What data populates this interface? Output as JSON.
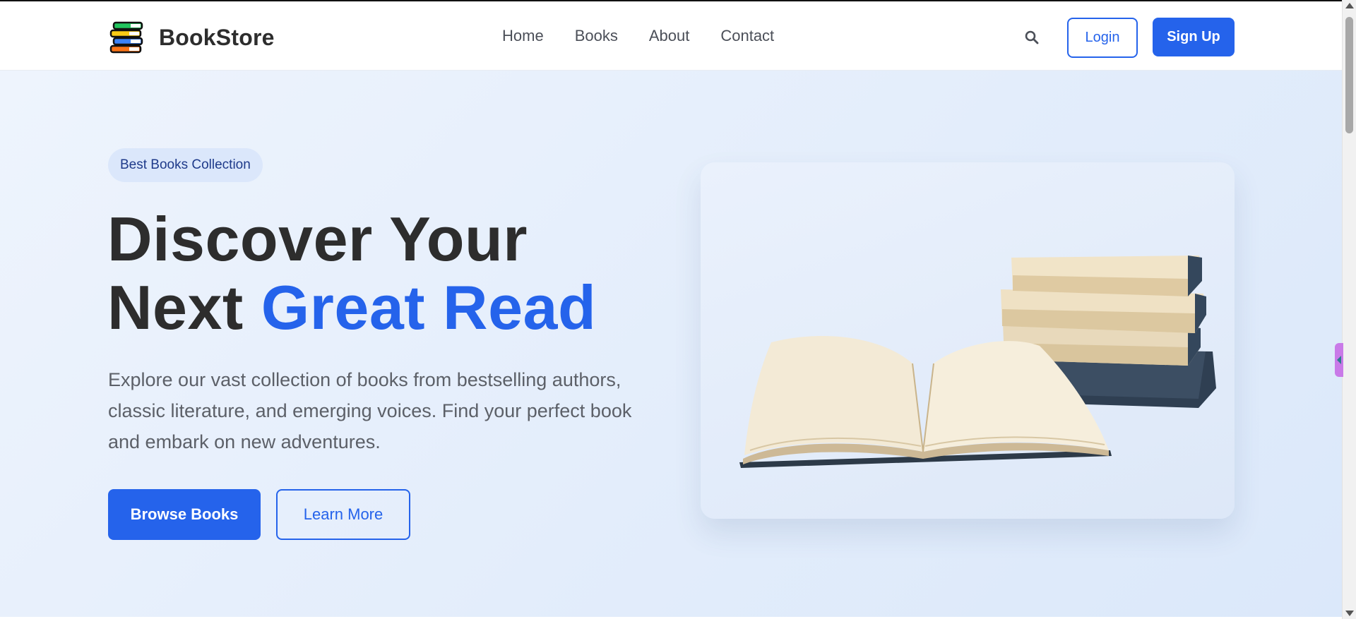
{
  "brand": {
    "name": "BookStore",
    "logo_icon": "book-stack-icon"
  },
  "nav": {
    "items": [
      {
        "label": "Home"
      },
      {
        "label": "Books"
      },
      {
        "label": "About"
      },
      {
        "label": "Contact"
      }
    ]
  },
  "header_actions": {
    "search_icon": "search-icon",
    "login_label": "Login",
    "signup_label": "Sign Up"
  },
  "hero": {
    "badge": "Best Books Collection",
    "headline_line1": "Discover Your",
    "headline_line2_plain": "Next",
    "headline_line2_accent": "Great Read",
    "description": "Explore our vast collection of books from bestselling authors, classic literature, and emerging voices. Find your perfect book and embark on new adventures.",
    "primary_button": "Browse Books",
    "secondary_button": "Learn More",
    "image": "open-book-and-stack-illustration"
  },
  "colors": {
    "accent": "#2563eb",
    "heading": "#2d2d2d",
    "body_text": "#5c6068",
    "hero_bg": "#e3edfb",
    "badge_bg": "#dbe7fb"
  }
}
